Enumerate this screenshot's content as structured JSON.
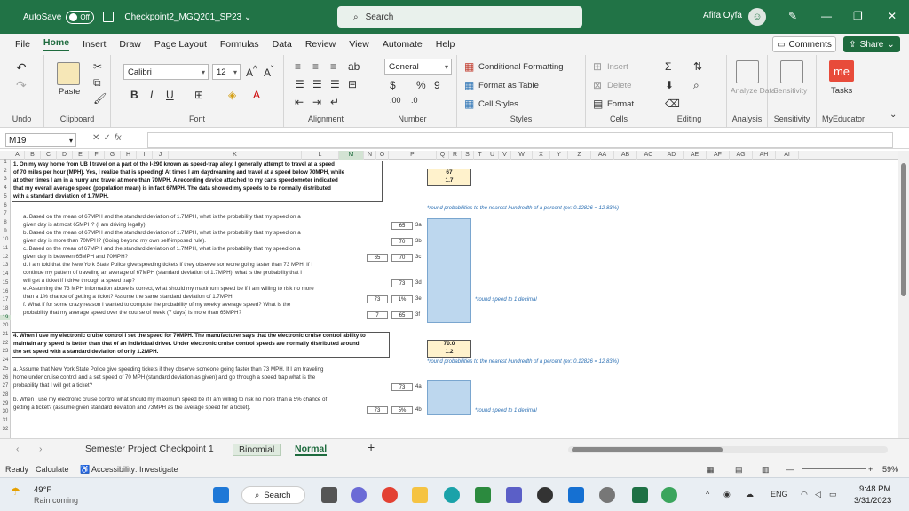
{
  "titlebar": {
    "autosave_label": "AutoSave",
    "autosave_state": "Off",
    "document_name": "Checkpoint2_MGQ201_SP23",
    "search_placeholder": "Search",
    "user_name": "Afifa Oyfa"
  },
  "menu": {
    "tabs": [
      "File",
      "Home",
      "Insert",
      "Draw",
      "Page Layout",
      "Formulas",
      "Data",
      "Review",
      "View",
      "Automate",
      "Help"
    ],
    "active": "Home",
    "comments_label": "Comments",
    "share_label": "Share"
  },
  "ribbon": {
    "undo_label": "Undo",
    "clipboard_label": "Clipboard",
    "paste_label": "Paste",
    "font_label": "Font",
    "font_name": "Calibri",
    "font_size": "12",
    "alignment_label": "Alignment",
    "number_label": "Number",
    "number_format": "General",
    "styles_label": "Styles",
    "conditional_formatting": "Conditional Formatting",
    "format_as_table": "Format as Table",
    "cell_styles": "Cell Styles",
    "cells_label": "Cells",
    "insert_label": "Insert",
    "delete_label": "Delete",
    "format_label": "Format",
    "editing_label": "Editing",
    "analysis_label": "Analysis",
    "analyze_data": "Analyze Data",
    "sensitivity_label": "Sensitivity",
    "tasks_label": "Tasks",
    "myeducator_label": "MyEducator"
  },
  "formula_bar": {
    "cell_ref": "M19",
    "fx": "fx",
    "value": ""
  },
  "grid": {
    "columns": [
      "A",
      "B",
      "C",
      "D",
      "E",
      "F",
      "G",
      "H",
      "I",
      "J",
      "K",
      "L",
      "M",
      "N",
      "O",
      "P",
      "Q",
      "R",
      "S",
      "T",
      "U",
      "V",
      "W",
      "X",
      "Y",
      "Z",
      "AA",
      "AB",
      "AC",
      "AD",
      "AE",
      "AF",
      "AG",
      "AH",
      "AI"
    ],
    "rows": [
      "1",
      "2",
      "3",
      "4",
      "5",
      "6",
      "7",
      "8",
      "9",
      "10",
      "11",
      "12",
      "13",
      "14",
      "15",
      "16",
      "17",
      "18",
      "19",
      "20",
      "21",
      "22",
      "23",
      "24",
      "25",
      "26",
      "27",
      "28",
      "29",
      "30",
      "31",
      "32"
    ],
    "problem1_lines": [
      "1. On my way home from UB I travel on a part of the I-290 known as speed-trap alley. I generally attempt to travel at a speed",
      "of 70 miles per hour (MPH). Yes, I realize that is speeding! At times I am daydreaming and travel at a speed below 70MPH, while",
      "at other times I am in a hurry and travel at more than 70MPH. A recording device attached to my car's speedometer indicated",
      "that my overall average speed (population mean) is in fact 67MPH. The data showed my speeds to be normally distributed",
      "with a standard deviation of 1.7MPH."
    ],
    "p1_mean": "67",
    "p1_sd": "1.7",
    "note_hundredth": "*round probabilities to the nearest hundredth of a percent  (ex: 0.12826 = 12.83%)",
    "qa": [
      "a. Based on the mean of 67MPH and the standard deviation of 1.7MPH, what is the probability that my speed on a",
      "given day is at most 65MPH? (I am driving legally).",
      "b. Based on the mean of 67MPH and the standard deviation of 1.7MPH, what is the probability that my speed on a",
      "given day is more than 70MPH? (Going beyond my own self-imposed rule).",
      "c. Based on the mean of 67MPH and the standard deviation of 1.7MPH, what is the probability that my speed on a",
      "given day is between 65MPH and 70MPH?",
      "d. I am told that the New York State Police give speeding tickets if they observe someone going faster than 73 MPH. If I",
      "continue my pattern of traveling an average of 67MPH (standard deviation of 1.7MPH), what is the probability that I",
      "will get a ticket if I drive through a speed trap?",
      "e. Assuming the 73 MPH information above is correct, what should my maximum speed be if I am willing to risk no more",
      "than a 1% chance of getting a ticket? Assume the same standard deviation of 1.7MPH.",
      "f. What if for some crazy reason I wanted to compute the probability of my weekly average speed? What is the",
      "probability that my average speed over the course of week (7 days) is more than 65MPH?"
    ],
    "small_cells": {
      "a_val": "65",
      "a_lbl": "3a",
      "b_val": "70",
      "b_lbl": "3b",
      "c_val1": "65",
      "c_val2": "70",
      "c_lbl": "3c",
      "d_val": "73",
      "d_lbl": "3d",
      "e_val1": "73",
      "e_val2": "1%",
      "e_lbl": "3e",
      "f_val1": "7",
      "f_val2": "65",
      "f_lbl": "3f"
    },
    "note_decimal": "*round speed to 1 decimal",
    "problem2_lines": [
      "4. When I use my electronic cruise control I set the speed for 70MPH. The manufacturer says that the electronic cruise control ability to",
      "maintain any speed is better than that of an individual driver. Under electronic cruise control speeds are normally distributed around",
      "the set speed with a standard deviation of only 1.2MPH."
    ],
    "p2_mean": "70.0",
    "p2_sd": "1.2",
    "q4": [
      "a. Assume that New York State Police give speeding tickets if they observe someone going faster than 73 MPH. If I am traveling",
      "home under cruise control and a set speed of 70 MPH (standard deviation as given) and go through a speed trap what is the",
      "probability that I will get a ticket?",
      "b. When I use my electronic cruise control what should my maximum speed be if I am willing to risk no more than a 5% chance of",
      "getting a ticket? (assume given standard deviation and 73MPH as the average speed for a ticket)."
    ],
    "q4_cells": {
      "a_val": "73",
      "a_lbl": "4a",
      "b_val1": "73",
      "b_val2": "5%",
      "b_lbl": "4b"
    }
  },
  "sheets": {
    "tabs": [
      "Semester Project Checkpoint 1",
      "Binomial",
      "Normal"
    ],
    "active": "Normal"
  },
  "status": {
    "ready": "Ready",
    "calculate": "Calculate",
    "accessibility": "Accessibility: Investigate",
    "zoom": "59%"
  },
  "taskbar": {
    "weather_temp": "49°F",
    "weather_desc": "Rain coming",
    "search_label": "Search",
    "lang": "ENG",
    "time": "9:48 PM",
    "date": "3/31/2023"
  }
}
